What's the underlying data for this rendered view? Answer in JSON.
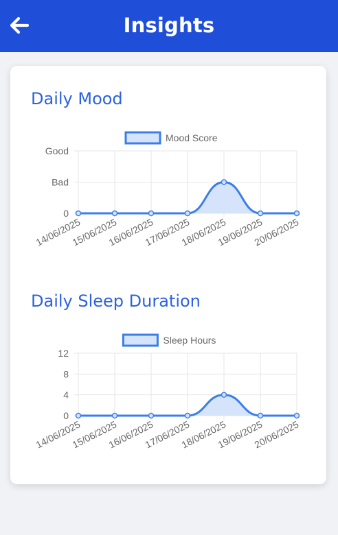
{
  "header": {
    "title": "Insights",
    "back_icon": "arrow-left-icon",
    "background_color": "#1f4fd8"
  },
  "charts": {
    "mood": {
      "title": "Daily Mood"
    },
    "sleep": {
      "title": "Daily Sleep Duration"
    }
  },
  "colors": {
    "accent": "#2c62df",
    "series_line": "#3b7ee8",
    "series_fill": "#d6e4fb"
  },
  "chart_data": [
    {
      "type": "line",
      "title": "Daily Mood",
      "x": [
        "14/06/2025",
        "15/06/2025",
        "16/06/2025",
        "17/06/2025",
        "18/06/2025",
        "19/06/2025",
        "20/06/2025"
      ],
      "y_ticks": [
        "0",
        "Bad",
        "Good"
      ],
      "series": [
        {
          "name": "Mood Score",
          "values": [
            0,
            0,
            0,
            0,
            1,
            0,
            0
          ]
        }
      ],
      "ylim": [
        0,
        2
      ],
      "legend": "top-center",
      "grid": true,
      "fill": true
    },
    {
      "type": "line",
      "title": "Daily Sleep Duration",
      "x": [
        "14/06/2025",
        "15/06/2025",
        "16/06/2025",
        "17/06/2025",
        "18/06/2025",
        "19/06/2025",
        "20/06/2025"
      ],
      "y_ticks": [
        "0",
        "4",
        "8",
        "12"
      ],
      "series": [
        {
          "name": "Sleep Hours",
          "values": [
            0,
            0,
            0,
            0,
            4,
            0,
            0
          ]
        }
      ],
      "ylim": [
        0,
        12
      ],
      "legend": "top-center",
      "grid": true,
      "fill": true
    }
  ]
}
